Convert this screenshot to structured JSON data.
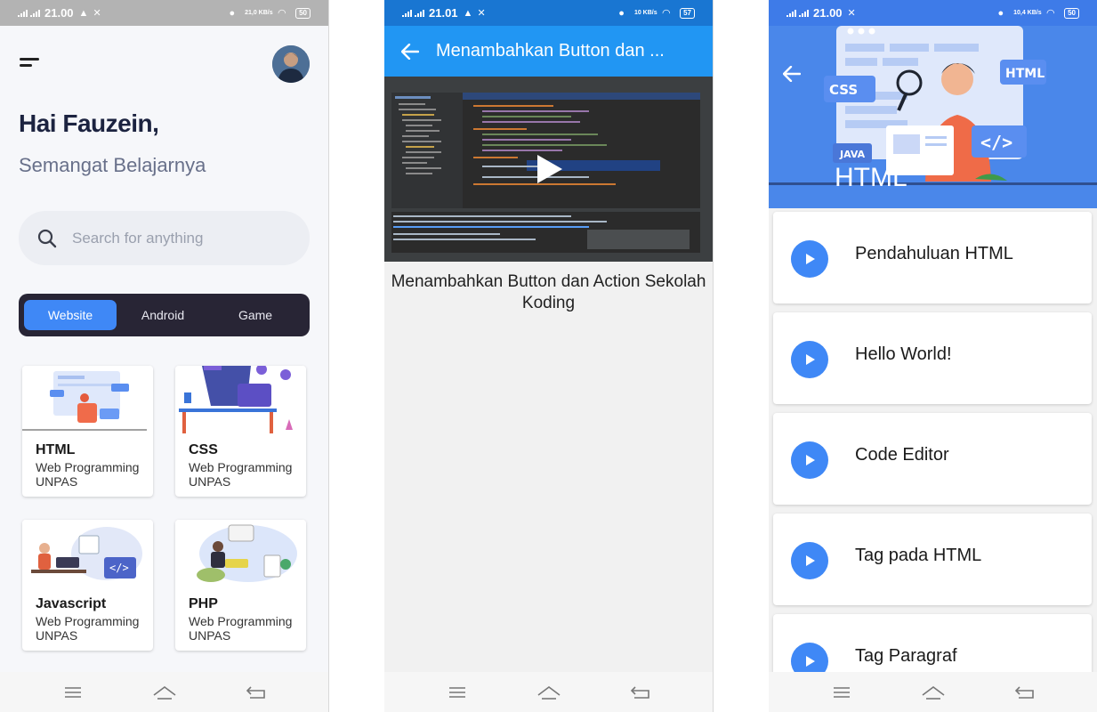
{
  "screens": [
    {
      "status": {
        "time": "21.00",
        "battery": "50",
        "speed": "21,0 KB/s"
      },
      "greeting": "Hai Fauzein,",
      "subtitle": "Semangat Belajarnya",
      "search": {
        "placeholder": "Search for anything"
      },
      "tabs": [
        {
          "label": "Website",
          "active": true
        },
        {
          "label": "Android",
          "active": false
        },
        {
          "label": "Game",
          "active": false
        }
      ],
      "courses": [
        {
          "title": "HTML",
          "subtitle": "Web Programming UNPAS"
        },
        {
          "title": "CSS",
          "subtitle": "Web Programming UNPAS"
        },
        {
          "title": "Javascript",
          "subtitle": "Web Programming UNPAS"
        },
        {
          "title": "PHP",
          "subtitle": "Web Programming UNPAS"
        }
      ]
    },
    {
      "status": {
        "time": "21.01",
        "battery": "57",
        "speed": "10 KB/s"
      },
      "appbar_title": "Menambahkan Button dan ...",
      "video_title": "Menambahkan Button dan Action Sekolah Koding"
    },
    {
      "status": {
        "time": "21.00",
        "battery": "50",
        "speed": "10,4 KB/s"
      },
      "hero_title": "HTML",
      "hero_labels": {
        "css": "CSS",
        "html": "HTML",
        "java": "JAVA",
        "code": "</>"
      },
      "lessons": [
        {
          "title": "Pendahuluan HTML"
        },
        {
          "title": "Hello World!"
        },
        {
          "title": "Code Editor"
        },
        {
          "title": "Tag pada HTML"
        },
        {
          "title": "Tag Paragraf"
        }
      ]
    }
  ],
  "colors": {
    "accent": "#3f88f6",
    "dark_tabs": "#282535",
    "appbar": "#2196f3",
    "hero": "#4a87ea"
  },
  "icons": {
    "menu": "menu-icon",
    "search": "search-icon",
    "back": "back-arrow-icon",
    "play": "play-icon"
  }
}
